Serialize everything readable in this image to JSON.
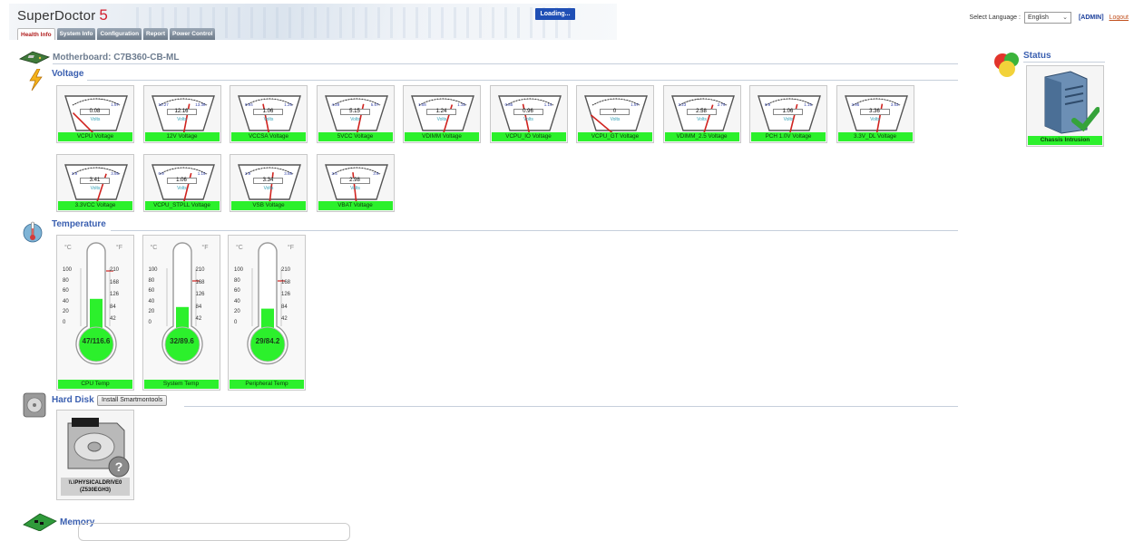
{
  "app": {
    "name": "SuperDoctor",
    "version": "5"
  },
  "loading": "Loading...",
  "tabs": [
    {
      "label": "Health Info"
    },
    {
      "label": "System Info"
    },
    {
      "label": "Configuration"
    },
    {
      "label": "Report"
    },
    {
      "label": "Power Control"
    }
  ],
  "header": {
    "language_label": "Select Language :",
    "language_value": "English",
    "admin": "[ADMIN]",
    "logout": "Logout"
  },
  "motherboard": "Motherboard: C7B360-CB-ML",
  "sections": {
    "voltage": "Voltage",
    "temperature": "Temperature",
    "hard_disk": "Hard Disk",
    "memory": "Memory",
    "status": "Status"
  },
  "voltage_unit": "Volts",
  "voltages": [
    {
      "label": "VCPU Voltage",
      "value": "0.08",
      "min": "",
      "max": "1.67"
    },
    {
      "label": "12V Voltage",
      "value": "12.16",
      "min": "10.27",
      "max": "13.38"
    },
    {
      "label": "VCCSA Voltage",
      "value": "1.06",
      "min": "0.94",
      "max": "1.25"
    },
    {
      "label": "5VCC Voltage",
      "value": "5.15",
      "min": "4.29",
      "max": "5.67"
    },
    {
      "label": "VDIMM Voltage",
      "value": "1.24",
      "min": "1.08",
      "max": "1.32"
    },
    {
      "label": "VCPU_IO Voltage",
      "value": "0.96",
      "min": "0.85",
      "max": "1.14"
    },
    {
      "label": "VCPU_GT Voltage",
      "value": "0",
      "min": "",
      "max": "1.67"
    },
    {
      "label": "VDIMM_2.5 Voltage",
      "value": "2.58",
      "min": "2.23",
      "max": "2.75"
    },
    {
      "label": "PCH 1.0V Voltage",
      "value": "1.06",
      "min": "0.9",
      "max": "1.15"
    },
    {
      "label": "3.3V_DL Voltage",
      "value": "3.36",
      "min": "2.95",
      "max": "3.63"
    },
    {
      "label": "3.3VCC Voltage",
      "value": "3.41",
      "min": "2.9",
      "max": "3.65"
    },
    {
      "label": "VCPU_STPLL Voltage",
      "value": "1.06",
      "min": "0.9",
      "max": "1.15"
    },
    {
      "label": "VSB Voltage",
      "value": "3.34",
      "min": "2.9",
      "max": "3.68"
    },
    {
      "label": "VBAT Voltage",
      "value": "2.98",
      "min": "2.5",
      "max": "3.6"
    }
  ],
  "temp_scale": {
    "c_unit": "°C",
    "f_unit": "°F",
    "c_ticks": [
      "100",
      "80",
      "60",
      "40",
      "20",
      "0"
    ],
    "f_ticks": [
      "210",
      "168",
      "126",
      "84",
      "42"
    ]
  },
  "temperatures": [
    {
      "label": "CPU Temp",
      "reading": "47/116.6",
      "celsius": 47
    },
    {
      "label": "System Temp",
      "reading": "32/89.6",
      "celsius": 32
    },
    {
      "label": "Peripheral Temp",
      "reading": "29/84.2",
      "celsius": 29
    }
  ],
  "hard_disk": {
    "install_button": "Install Smartmontools",
    "drive_name": "\\\\.\\PHYSICALDRIVE0",
    "drive_id": "(Z530EGH3)"
  },
  "status": {
    "label": "Chassis Intrusion"
  },
  "colors": {
    "ok_green": "#2cf02c",
    "title_blue": "#3a5fb0",
    "needle_red": "#d0231f",
    "version_red": "#d2202f"
  }
}
